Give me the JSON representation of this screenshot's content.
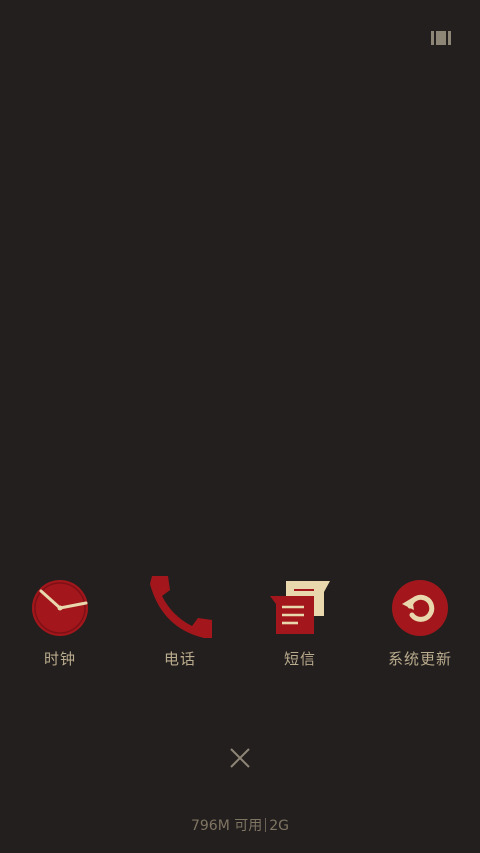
{
  "dock": {
    "apps": [
      {
        "label": "时钟",
        "icon": "clock-icon"
      },
      {
        "label": "电话",
        "icon": "phone-icon"
      },
      {
        "label": "短信",
        "icon": "messages-icon"
      },
      {
        "label": "系统更新",
        "icon": "system-update-icon"
      }
    ]
  },
  "footer": {
    "memory_available": "796M 可用",
    "memory_total": "2G"
  },
  "colors": {
    "background": "#231f1e",
    "accent_red": "#a3171c",
    "accent_cream": "#e9d7ae",
    "label": "#b9ab8d"
  }
}
